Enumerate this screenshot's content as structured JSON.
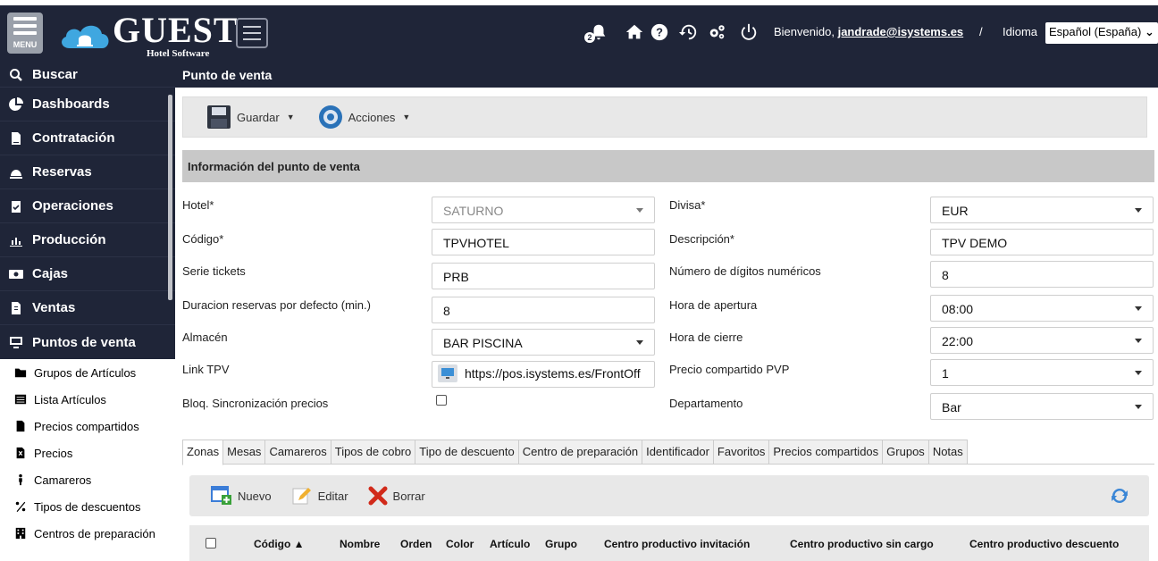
{
  "app": {
    "menu_label": "MENU",
    "logo_word": "GUEST",
    "logo_sub": "Hotel Software",
    "welcome_prefix": "Bienvenido,",
    "user": "jandrade@isystems.es",
    "sep": "/",
    "idioma_label": "Idioma",
    "idioma_value": "Español (España)",
    "notif_count": "2"
  },
  "sidebar": {
    "main": [
      {
        "label": "Buscar",
        "icon": "search-icon"
      },
      {
        "label": "Dashboards",
        "icon": "pie-chart-icon"
      },
      {
        "label": "Contratación",
        "icon": "contract-icon"
      },
      {
        "label": "Reservas",
        "icon": "bell-icon"
      },
      {
        "label": "Operaciones",
        "icon": "clipboard-icon"
      },
      {
        "label": "Producción",
        "icon": "bar-chart-icon"
      },
      {
        "label": "Cajas",
        "icon": "money-icon"
      },
      {
        "label": "Ventas",
        "icon": "invoice-icon"
      },
      {
        "label": "Puntos de venta",
        "icon": "desktop-icon"
      }
    ],
    "sub": [
      {
        "label": "Grupos de Artículos",
        "icon": "folder-icon"
      },
      {
        "label": "Lista Artículos",
        "icon": "list-icon"
      },
      {
        "label": "Precios compartidos",
        "icon": "file-icon"
      },
      {
        "label": "Precios",
        "icon": "price-file-icon"
      },
      {
        "label": "Camareros",
        "icon": "person-icon"
      },
      {
        "label": "Tipos de descuentos",
        "icon": "percent-icon"
      },
      {
        "label": "Centros de preparación",
        "icon": "building-icon"
      }
    ]
  },
  "page": {
    "title": "Punto de venta",
    "save_label": "Guardar",
    "actions_label": "Acciones",
    "section_title": "Información del punto de venta"
  },
  "form": {
    "hotel": {
      "label": "Hotel*",
      "value": "SATURNO"
    },
    "codigo": {
      "label": "Código*",
      "value": "TPVHOTEL"
    },
    "serie": {
      "label": "Serie tickets",
      "value": "PRB"
    },
    "duracion": {
      "label": "Duracion reservas por defecto (min.)",
      "value": "8"
    },
    "almacen": {
      "label": "Almacén",
      "value": "BAR PISCINA"
    },
    "link": {
      "label": "Link TPV",
      "value": "https://pos.isystems.es/FrontOff"
    },
    "bloq": {
      "label": "Bloq. Sincronización precios",
      "checked": false
    },
    "divisa": {
      "label": "Divisa*",
      "value": "EUR"
    },
    "descripcion": {
      "label": "Descripción*",
      "value": "TPV DEMO"
    },
    "digitos": {
      "label": "Número de dígitos numéricos",
      "value": "8"
    },
    "apertura": {
      "label": "Hora de apertura",
      "value": "08:00"
    },
    "cierre": {
      "label": "Hora de cierre",
      "value": "22:00"
    },
    "precio": {
      "label": "Precio compartido PVP",
      "value": "1"
    },
    "departamento": {
      "label": "Departamento",
      "value": "Bar"
    }
  },
  "tabs": [
    "Zonas",
    "Mesas",
    "Camareros",
    "Tipos de cobro",
    "Tipo de descuento",
    "Centro de preparación",
    "Identificador",
    "Favoritos",
    "Precios compartidos",
    "Grupos",
    "Notas"
  ],
  "grid": {
    "new_label": "Nuevo",
    "edit_label": "Editar",
    "delete_label": "Borrar",
    "columns": [
      "Código",
      "Nombre",
      "Orden",
      "Color",
      "Artículo",
      "Grupo",
      "Centro productivo invitación",
      "Centro productivo sin cargo",
      "Centro productivo descuento"
    ]
  }
}
